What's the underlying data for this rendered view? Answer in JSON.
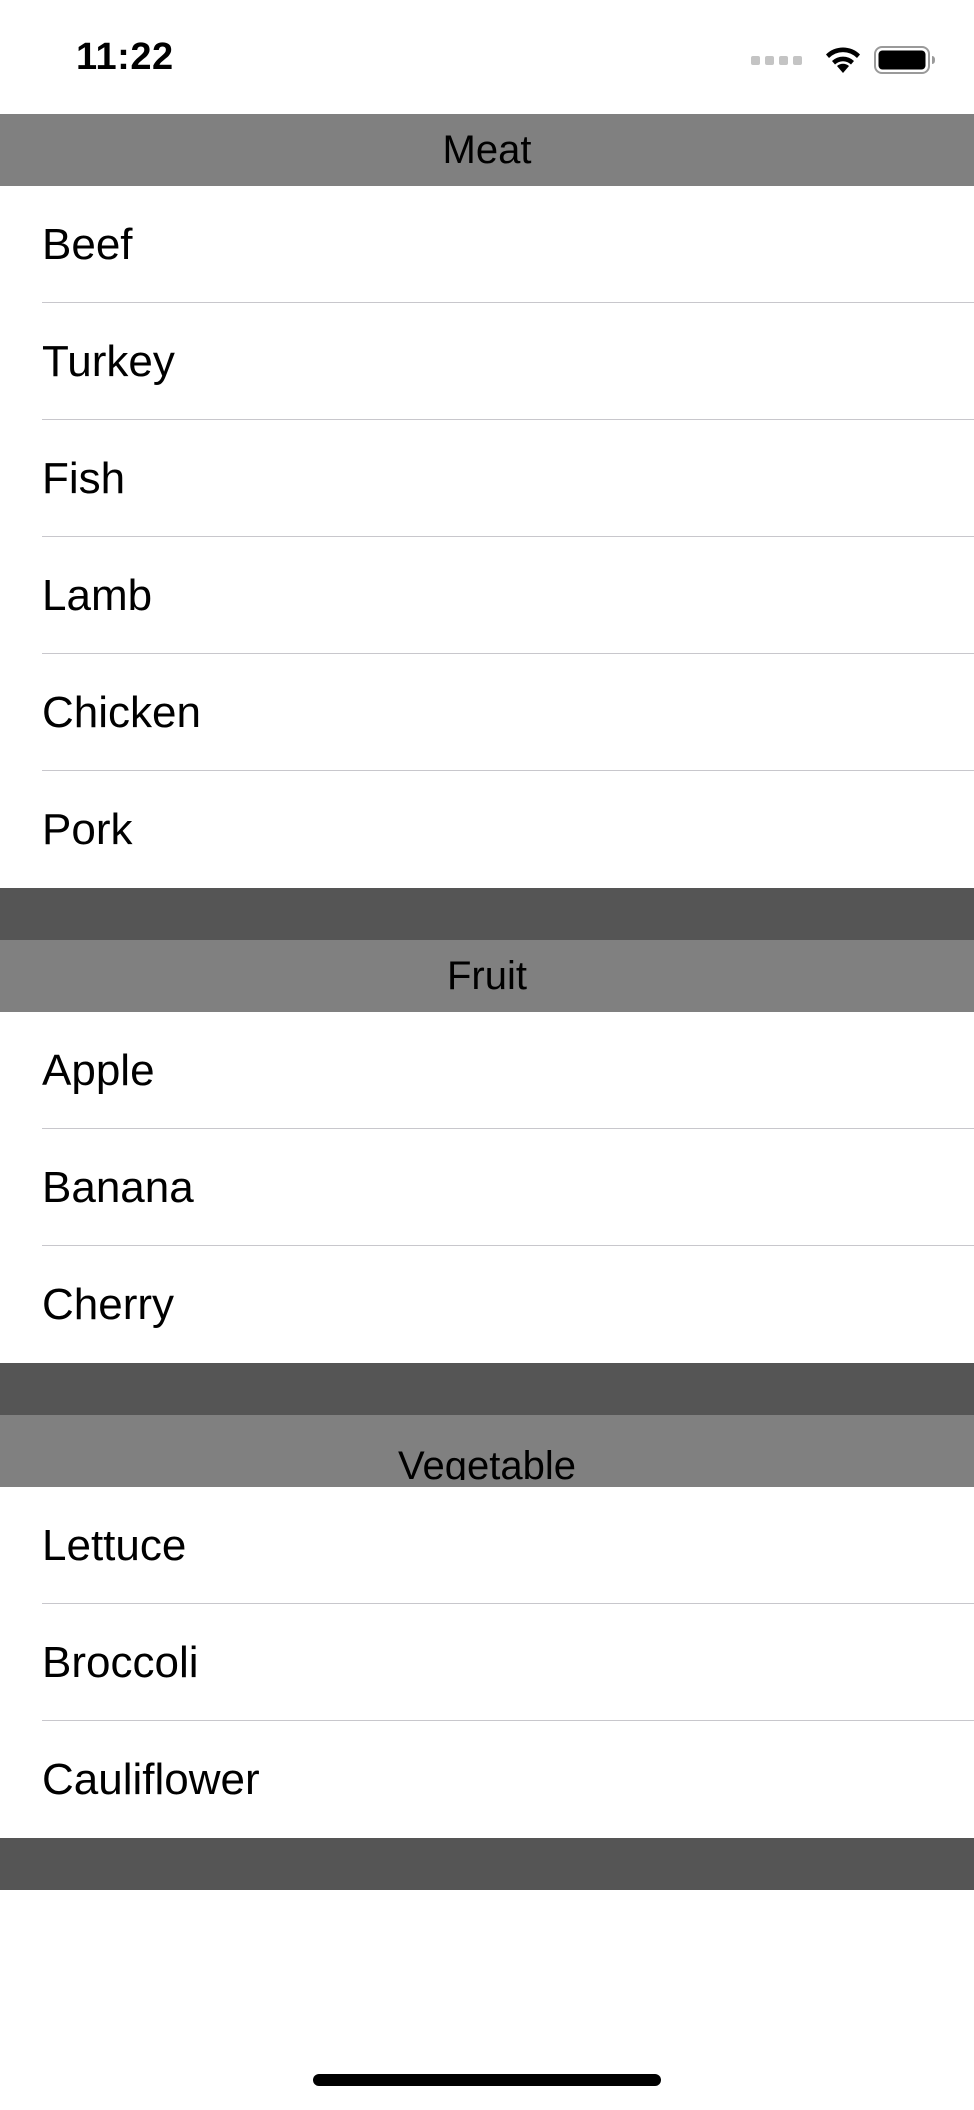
{
  "status_bar": {
    "time": "11:22",
    "icons": [
      "signal-dots-icon",
      "wifi-icon",
      "battery-icon"
    ]
  },
  "sections": [
    {
      "title": "Meat",
      "items": [
        "Beef",
        "Turkey",
        "Fish",
        "Lamb",
        "Chicken",
        "Pork"
      ]
    },
    {
      "title": "Fruit",
      "items": [
        "Apple",
        "Banana",
        "Cherry"
      ]
    },
    {
      "title": "Vegetable",
      "items": [
        "Lettuce",
        "Broccoli",
        "Cauliflower"
      ]
    }
  ],
  "colors": {
    "header_bg": "#808080",
    "footer_bg": "#555555",
    "separator": "#c8c7cc",
    "background": "#ffffff"
  }
}
